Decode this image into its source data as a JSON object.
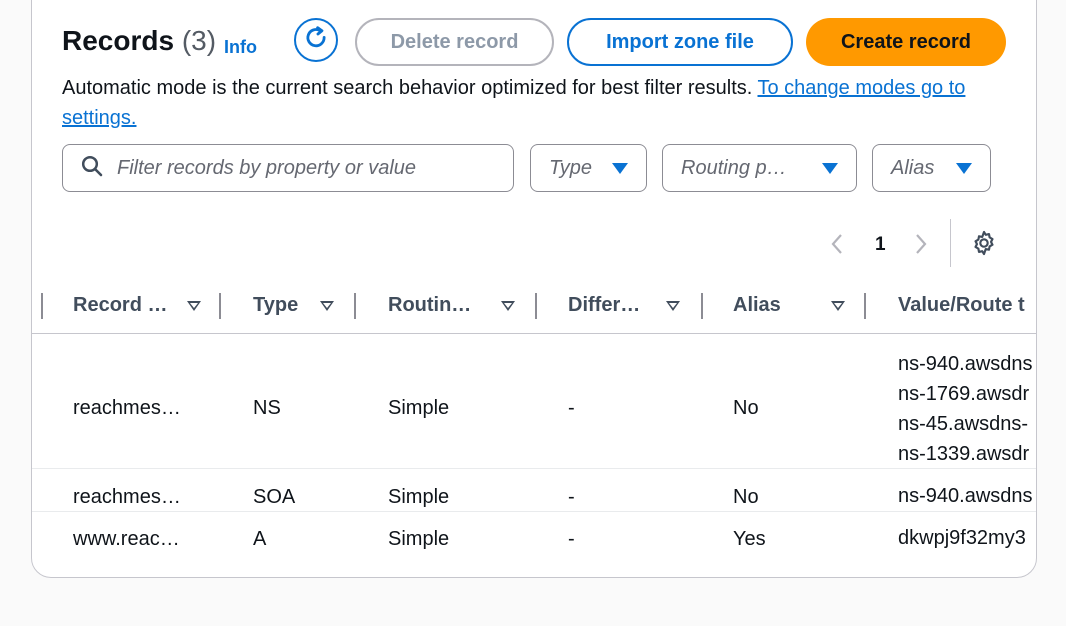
{
  "header": {
    "title": "Records",
    "count": "(3)",
    "info": "Info",
    "buttons": {
      "delete": "Delete record",
      "import": "Import zone file",
      "create": "Create record"
    },
    "description": "Automatic mode is the current search behavior optimized for best filter results. ",
    "description_link": "To change modes go to settings."
  },
  "filters": {
    "search_placeholder": "Filter records by property or value",
    "type": "Type",
    "routing": "Routing p…",
    "alias": "Alias"
  },
  "pagination": {
    "current_page": "1"
  },
  "table": {
    "columns": [
      "Record …",
      "Type",
      "Routin…",
      "Differ…",
      "Alias",
      "Value/Route t"
    ],
    "rows": [
      {
        "name": "reachmes…",
        "type": "NS",
        "routing": "Simple",
        "differ": "-",
        "alias": "No",
        "values": [
          "ns-940.awsdns",
          "ns-1769.awsdr",
          "ns-45.awsdns-",
          "ns-1339.awsdr"
        ]
      },
      {
        "name": "reachmes…",
        "type": "SOA",
        "routing": "Simple",
        "differ": "-",
        "alias": "No",
        "values": [
          "ns-940.awsdns"
        ]
      },
      {
        "name": "www.reac…",
        "type": "A",
        "routing": "Simple",
        "differ": "-",
        "alias": "Yes",
        "values": [
          "dkwpj9f32my3"
        ]
      }
    ]
  },
  "colors": {
    "accent": "#0972d3",
    "primary": "#ff9900",
    "disabled": "#b4b4bb"
  }
}
